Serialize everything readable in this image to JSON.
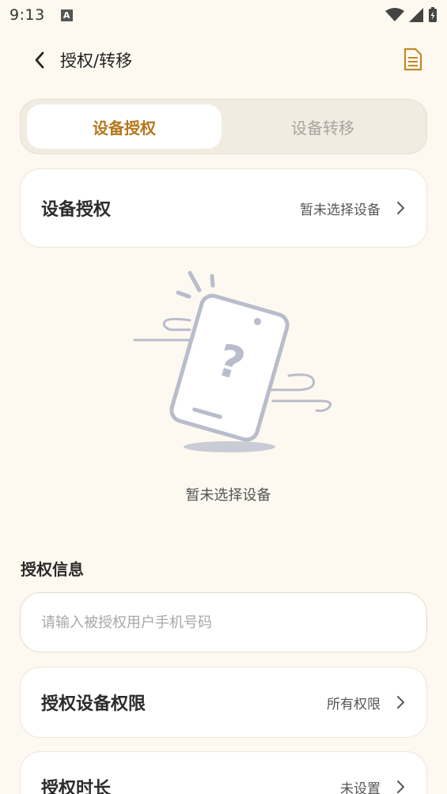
{
  "status_bar": {
    "time": "9:13",
    "notification_icon": "A"
  },
  "header": {
    "title": "授权/转移",
    "back_icon": "chevron-left-icon",
    "doc_icon": "document-icon"
  },
  "tabs": [
    {
      "label": "设备授权",
      "active": true
    },
    {
      "label": "设备转移",
      "active": false
    }
  ],
  "device_card": {
    "title": "设备授权",
    "value": "暂未选择设备"
  },
  "empty_state": {
    "text": "暂未选择设备"
  },
  "auth_info": {
    "section_title": "授权信息",
    "phone_placeholder": "请输入被授权用户手机号码",
    "phone_value": ""
  },
  "permission_card": {
    "title": "授权设备权限",
    "value": "所有权限"
  },
  "duration_card": {
    "title": "授权时长",
    "value": "未设置"
  },
  "colors": {
    "accent": "#b5781d",
    "background": "#fdf9f0",
    "doc_icon": "#c28a2a",
    "illustration": "#b8bccb"
  }
}
